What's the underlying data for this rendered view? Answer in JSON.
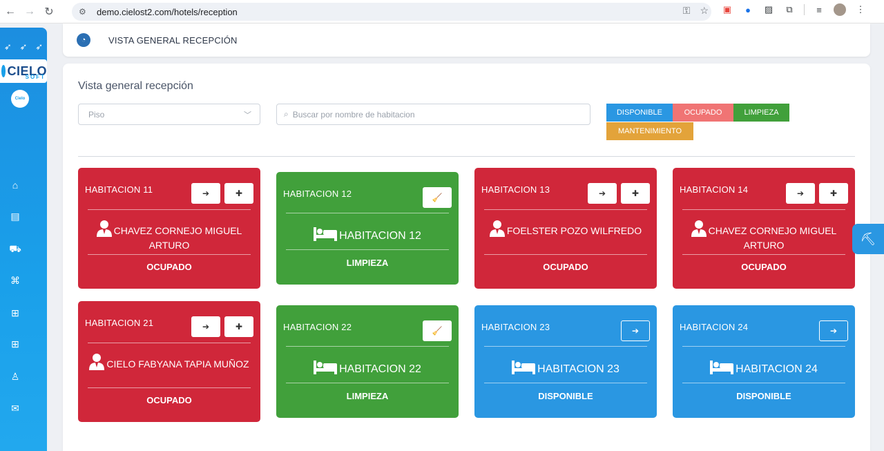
{
  "browser": {
    "url": "demo.cielost2.com/hotels/reception"
  },
  "sidebar": {
    "brand": "CIELO",
    "brand_sub": "SOFT",
    "avatar_label": "Cielo"
  },
  "header": {
    "title": "VISTA GENERAL RECEPCIÓN"
  },
  "main": {
    "title": "Vista general recepción",
    "floor_select": {
      "placeholder": "Piso"
    },
    "search": {
      "placeholder": "Buscar por nombre de habitacion"
    },
    "legend": [
      {
        "label": "DISPONIBLE",
        "color": "#2a97e2"
      },
      {
        "label": "OCUPADO",
        "color": "#f07474"
      },
      {
        "label": "LIMPIEZA",
        "color": "#41a03b"
      },
      {
        "label": "MANTENIMIENTO",
        "color": "#e3a33a"
      }
    ]
  },
  "rooms": [
    {
      "name": "HABITACION 11",
      "state": "red",
      "guest": "CHAVEZ CORNEJO MIGUEL ARTURO",
      "status": "OCUPADO"
    },
    {
      "name": "HABITACION 12",
      "state": "green",
      "room_label": "HABITACION 12",
      "status": "LIMPIEZA"
    },
    {
      "name": "HABITACION 13",
      "state": "red",
      "guest": "FOELSTER POZO WILFREDO",
      "status": "OCUPADO"
    },
    {
      "name": "HABITACION 14",
      "state": "red",
      "guest": "CHAVEZ CORNEJO MIGUEL ARTURO",
      "status": "OCUPADO"
    },
    {
      "name": "HABITACION 21",
      "state": "red",
      "guest": "CIELO FABYANA TAPIA MUÑOZ",
      "status": "OCUPADO"
    },
    {
      "name": "HABITACION 22",
      "state": "green",
      "room_label": "HABITACION 22",
      "status": "LIMPIEZA"
    },
    {
      "name": "HABITACION 23",
      "state": "blue",
      "room_label": "HABITACION 23",
      "status": "DISPONIBLE"
    },
    {
      "name": "HABITACION 24",
      "state": "blue",
      "room_label": "HABITACION 24",
      "status": "DISPONIBLE"
    }
  ],
  "colors": {
    "occupied": "#d0273a",
    "cleaning": "#41a03b",
    "available": "#2a97e2",
    "sidebar": "#1c8ee0"
  }
}
